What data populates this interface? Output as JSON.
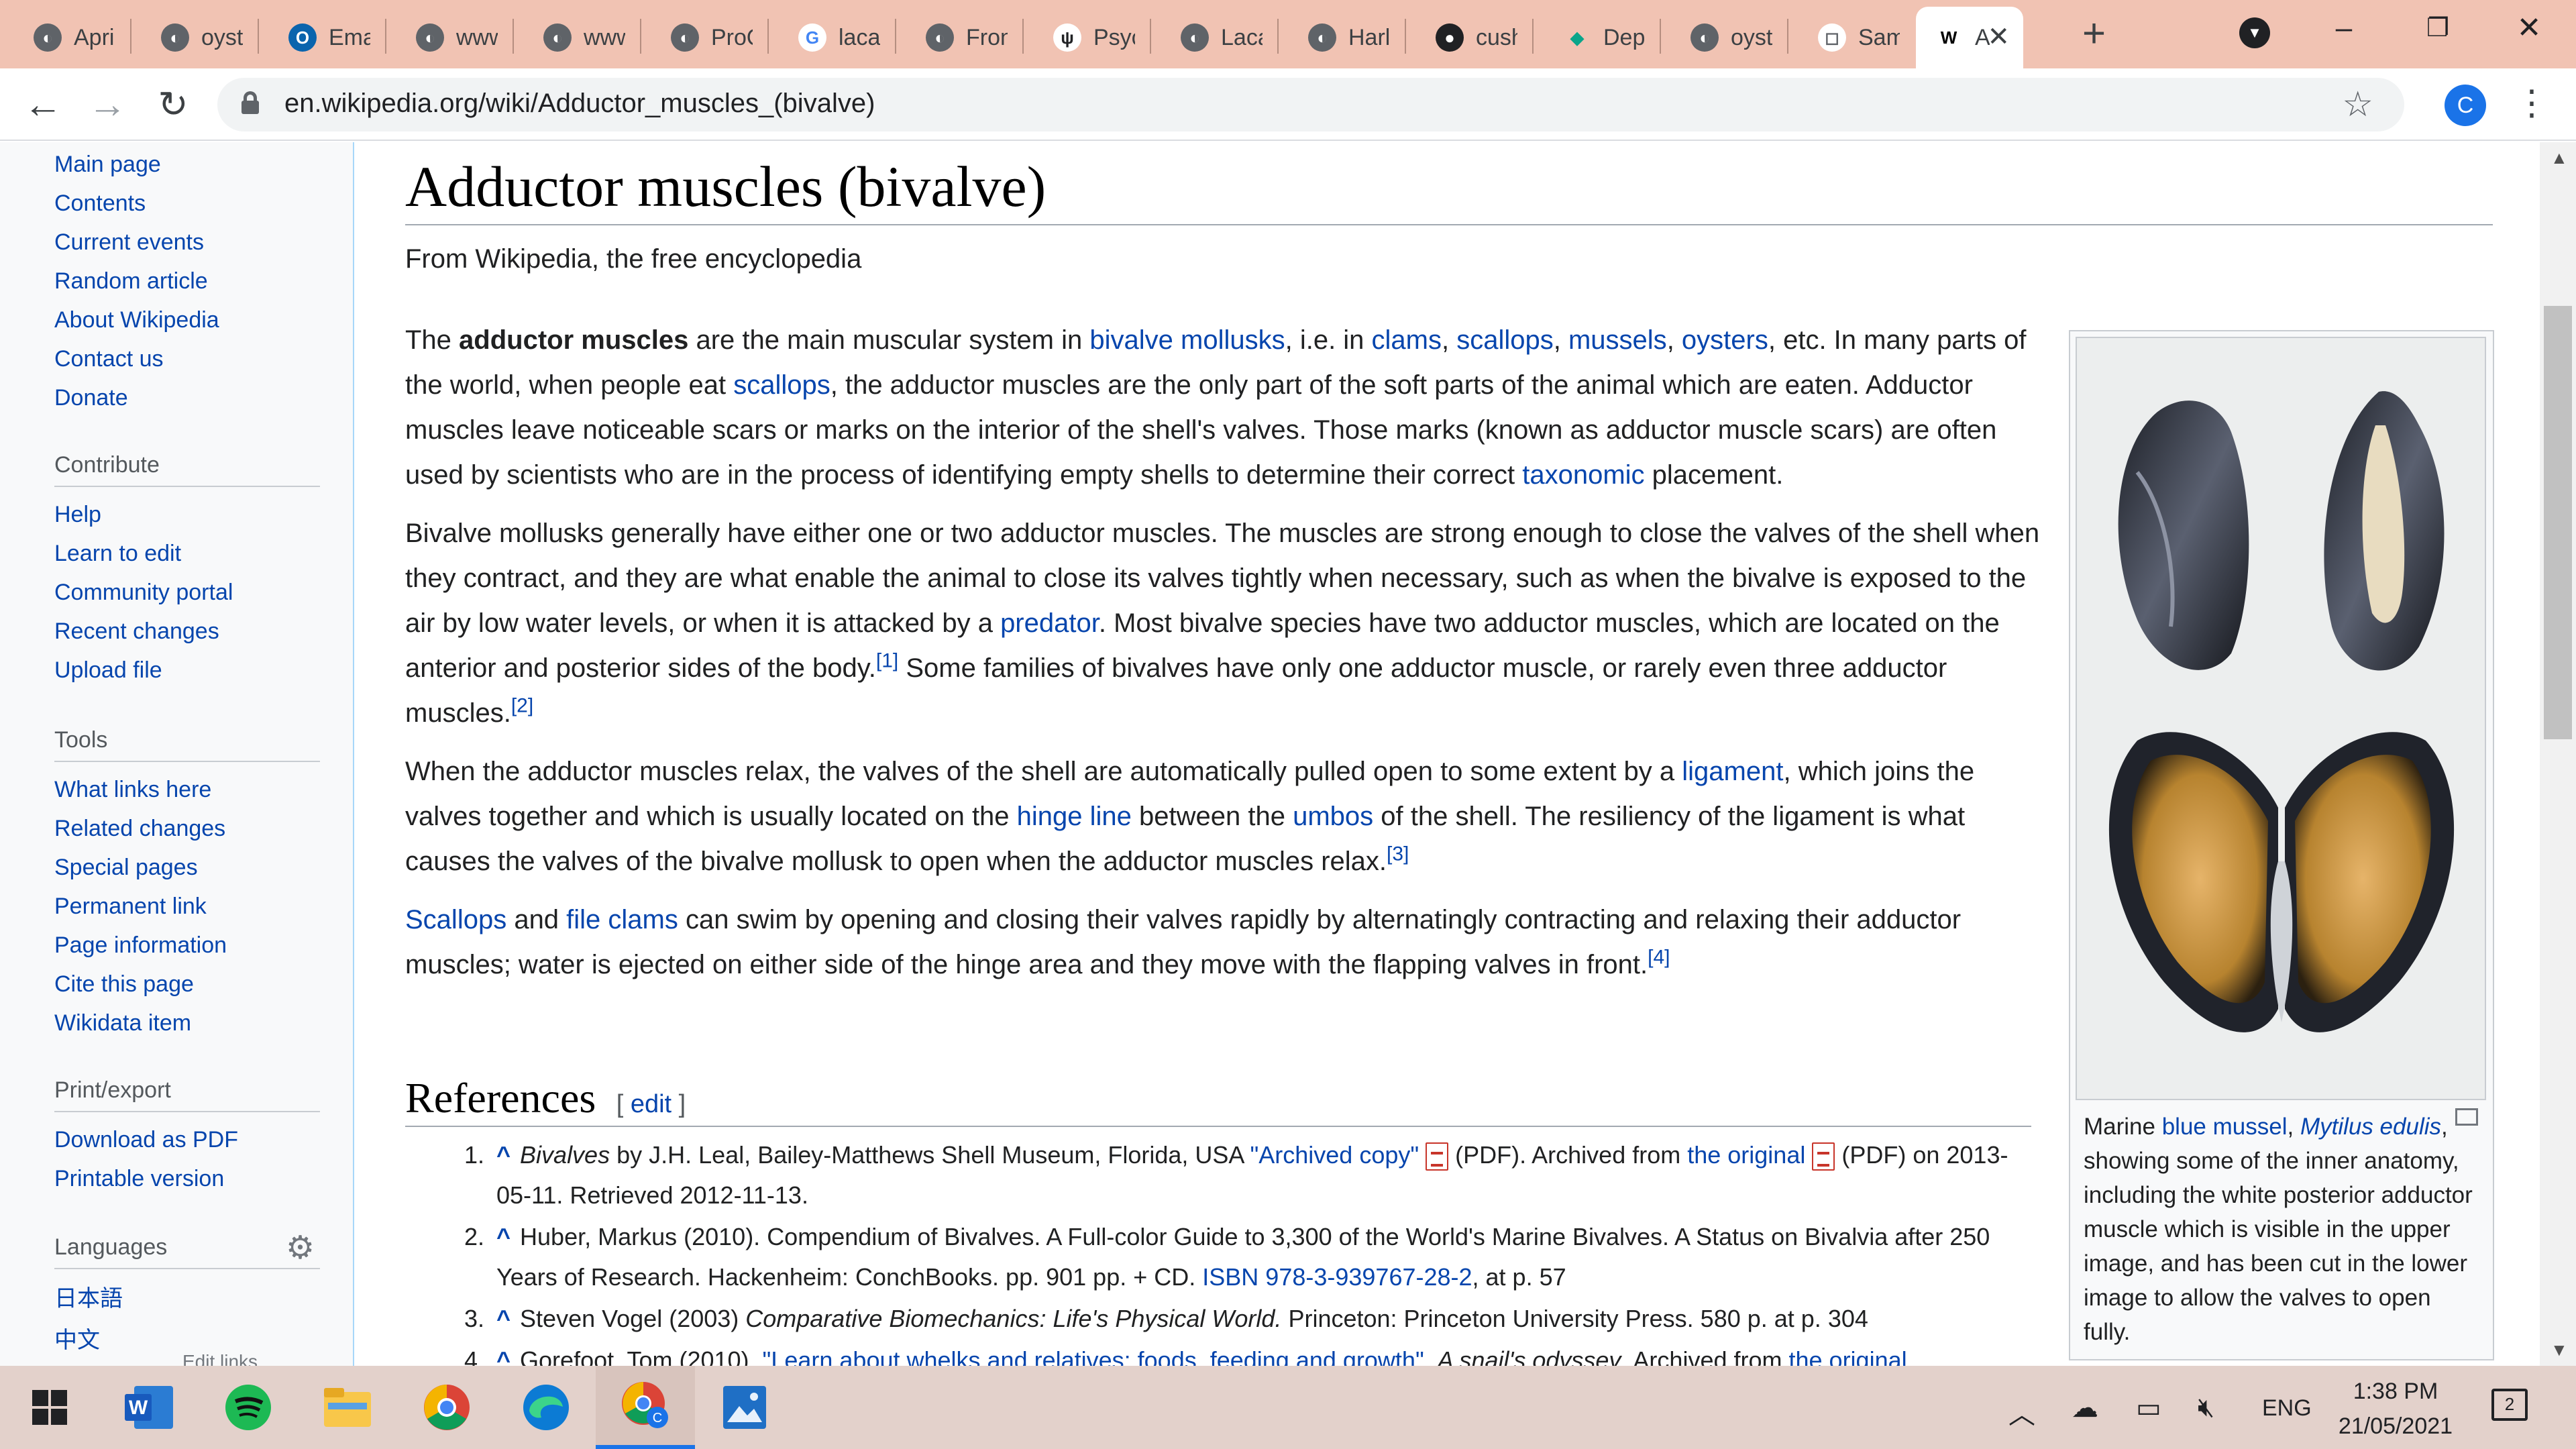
{
  "browser": {
    "tabs": [
      {
        "label": "April",
        "icon": "globe-icon"
      },
      {
        "label": "oysters",
        "icon": "globe-icon"
      },
      {
        "label": "Email",
        "icon": "outlook-icon"
      },
      {
        "label": "www",
        "icon": "globe-icon"
      },
      {
        "label": "www",
        "icon": "globe-icon"
      },
      {
        "label": "ProQuest",
        "icon": "globe-icon"
      },
      {
        "label": "lacan",
        "icon": "google-icon"
      },
      {
        "label": "Frontiers",
        "icon": "globe-icon"
      },
      {
        "label": "Psych",
        "icon": "psych-icon"
      },
      {
        "label": "Lacan",
        "icon": "globe-icon"
      },
      {
        "label": "Harl",
        "icon": "globe-icon"
      },
      {
        "label": "cush",
        "icon": "github-icon"
      },
      {
        "label": "Dep",
        "icon": "diamond-icon"
      },
      {
        "label": "oyst",
        "icon": "globe-icon"
      },
      {
        "label": "Sam",
        "icon": "cube-icon"
      },
      {
        "label": "A",
        "icon": "wikipedia-icon",
        "active": true
      }
    ],
    "url": "en.wikipedia.org/wiki/Adductor_muscles_(bivalve)",
    "profile_initial": "C"
  },
  "sidebar": {
    "navigation": [
      "Main page",
      "Contents",
      "Current events",
      "Random article",
      "About Wikipedia",
      "Contact us",
      "Donate"
    ],
    "contribute_heading": "Contribute",
    "contribute": [
      "Help",
      "Learn to edit",
      "Community portal",
      "Recent changes",
      "Upload file"
    ],
    "tools_heading": "Tools",
    "tools": [
      "What links here",
      "Related changes",
      "Special pages",
      "Permanent link",
      "Page information",
      "Cite this page",
      "Wikidata item"
    ],
    "print_heading": "Print/export",
    "print": [
      "Download as PDF",
      "Printable version"
    ],
    "languages_heading": "Languages",
    "languages": [
      "日本語",
      "中文"
    ],
    "edit_links": "Edit links"
  },
  "article": {
    "title": "Adductor muscles (bivalve)",
    "tagline": "From Wikipedia, the free encyclopedia",
    "paragraphs": [
      [
        {
          "t": "The "
        },
        {
          "t": "adductor muscles",
          "b": true
        },
        {
          "t": " are the main muscular system in "
        },
        {
          "t": "bivalve mollusks",
          "link": true
        },
        {
          "t": ", i.e. in "
        },
        {
          "t": "clams",
          "link": true
        },
        {
          "t": ", "
        },
        {
          "t": "scallops",
          "link": true
        },
        {
          "t": ", "
        },
        {
          "t": "mussels",
          "link": true
        },
        {
          "t": ", "
        },
        {
          "t": "oysters",
          "link": true
        },
        {
          "t": ", etc. In many parts of the world, when people eat "
        },
        {
          "t": "scallops",
          "link": true
        },
        {
          "t": ", the adductor muscles are the only part of the soft parts of the animal which are eaten. Adductor muscles leave noticeable scars or marks on the interior of the shell's valves. Those marks (known as adductor muscle scars) are often used by scientists who are in the process of identifying empty shells to determine their correct "
        },
        {
          "t": "taxonomic",
          "link": true
        },
        {
          "t": " placement."
        }
      ],
      [
        {
          "t": "Bivalve mollusks generally have either one or two adductor muscles. The muscles are strong enough to close the valves of the shell when they contract, and they are what enable the animal to close its valves tightly when necessary, such as when the bivalve is exposed to the air by low water levels, or when it is attacked by a "
        },
        {
          "t": "predator",
          "link": true
        },
        {
          "t": ". Most bivalve species have two adductor muscles, which are located on the anterior and posterior sides of the body."
        },
        {
          "t": "[1]",
          "sup": true
        },
        {
          "t": " Some families of bivalves have only one adductor muscle, or rarely even three adductor muscles."
        },
        {
          "t": "[2]",
          "sup": true
        }
      ],
      [
        {
          "t": "When the adductor muscles relax, the valves of the shell are automatically pulled open to some extent by a "
        },
        {
          "t": "ligament",
          "link": true
        },
        {
          "t": ", which joins the valves together and which is usually located on the "
        },
        {
          "t": "hinge line",
          "link": true
        },
        {
          "t": " between the "
        },
        {
          "t": "umbos",
          "link": true
        },
        {
          "t": " of the shell. The resiliency of the ligament is what causes the valves of the bivalve mollusk to open when the adductor muscles relax."
        },
        {
          "t": "[3]",
          "sup": true
        }
      ],
      [
        {
          "t": "Scallops",
          "link": true
        },
        {
          "t": " and "
        },
        {
          "t": "file clams",
          "link": true
        },
        {
          "t": " can swim by opening and closing their valves rapidly by alternatingly contracting and relaxing their adductor muscles; water is ejected on either side of the hinge area and they move with the flapping valves in front."
        },
        {
          "t": "[4]",
          "sup": true
        }
      ]
    ],
    "references_heading": "References",
    "edit_label": "edit",
    "references": [
      [
        {
          "t": "Bivalves",
          "i": true
        },
        {
          "t": " by J.H. Leal, Bailey-Matthews Shell Museum, Florida, USA "
        },
        {
          "t": "\"Archived copy\"",
          "link": true
        },
        {
          "pdf": true
        },
        {
          "t": " (PDF). Archived from "
        },
        {
          "t": "the original",
          "link": true
        },
        {
          "pdf": true
        },
        {
          "t": " (PDF) on 2013-05-11. Retrieved 2012-11-13."
        }
      ],
      [
        {
          "t": "Huber, Markus (2010). Compendium of Bivalves. A Full-color Guide to 3,300 of the World's Marine Bivalves. A Status on Bivalvia after 250 Years of Research. Hackenheim: ConchBooks. pp. 901 pp. + CD. "
        },
        {
          "t": "ISBN",
          "link": true
        },
        {
          "t": " "
        },
        {
          "t": "978-3-939767-28-2",
          "link": true
        },
        {
          "t": ", at p. 57"
        }
      ],
      [
        {
          "t": "Steven Vogel (2003) "
        },
        {
          "t": "Comparative Biomechanics: Life's Physical World.",
          "i": true
        },
        {
          "t": " Princeton: Princeton University Press. 580 p. at p. 304"
        }
      ],
      [
        {
          "t": "Gorefoot, Tom (2010). "
        },
        {
          "t": "\"Learn about whelks and relatives: foods, feeding and growth\"",
          "link": true
        },
        {
          "t": ". "
        },
        {
          "t": "A snail's odyssey",
          "i": true
        },
        {
          "t": ". Archived from "
        },
        {
          "t": "the original",
          "link": true
        }
      ]
    ],
    "figure_caption": [
      {
        "t": "Marine "
      },
      {
        "t": "blue mussel",
        "link": true
      },
      {
        "t": ", "
      },
      {
        "t": "Mytilus edulis",
        "link": true,
        "i": true
      },
      {
        "t": ", showing some of the inner anatomy, including the white posterior adductor muscle which is visible in the upper image, and has been cut in the lower image to allow the valves to open fully."
      }
    ]
  },
  "taskbar": {
    "apps": [
      "windows-start-icon",
      "word-icon",
      "spotify-icon",
      "file-explorer-icon",
      "chrome-icon",
      "edge-icon",
      "chrome-profile-icon",
      "photos-icon"
    ],
    "language": "ENG",
    "time": "1:38 PM",
    "date": "21/05/2021",
    "notifications": "2"
  },
  "colors": {
    "link": "#0645ad",
    "tabstrip": "#f1c3b3",
    "taskbar": "#e3d1cb",
    "sidebar": "#f8f9fa"
  }
}
